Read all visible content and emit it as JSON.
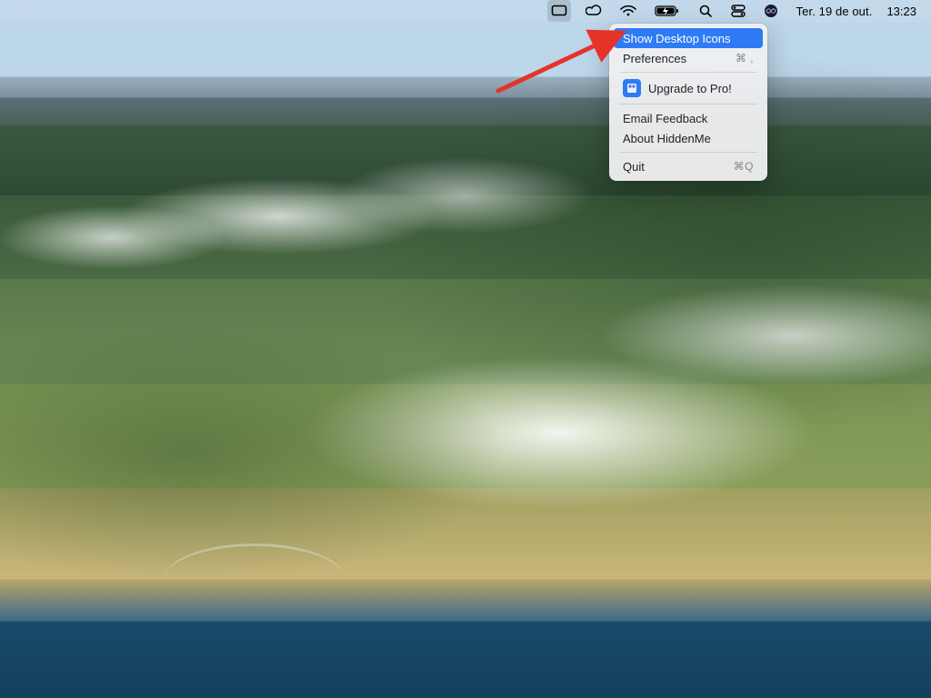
{
  "menubar": {
    "date_text": "Ter. 19 de out.",
    "time_text": "13:23",
    "icons": {
      "hiddenme": "hiddenme-icon",
      "creative_cloud": "creative-cloud-icon",
      "wifi": "wifi-icon",
      "battery": "battery-charging-icon",
      "spotlight": "spotlight-icon",
      "control_center": "control-center-icon",
      "siri": "siri-icon"
    }
  },
  "dropdown": {
    "items": [
      {
        "label": "Show Desktop Icons",
        "shortcut": ""
      },
      {
        "label": "Preferences",
        "shortcut": "⌘ ,"
      },
      {
        "label": "Upgrade to Pro!",
        "shortcut": ""
      },
      {
        "label": "Email Feedback",
        "shortcut": ""
      },
      {
        "label": "About HiddenMe",
        "shortcut": ""
      },
      {
        "label": "Quit",
        "shortcut": "⌘Q"
      }
    ]
  },
  "annotation": {
    "arrow_color": "#e6332a"
  }
}
